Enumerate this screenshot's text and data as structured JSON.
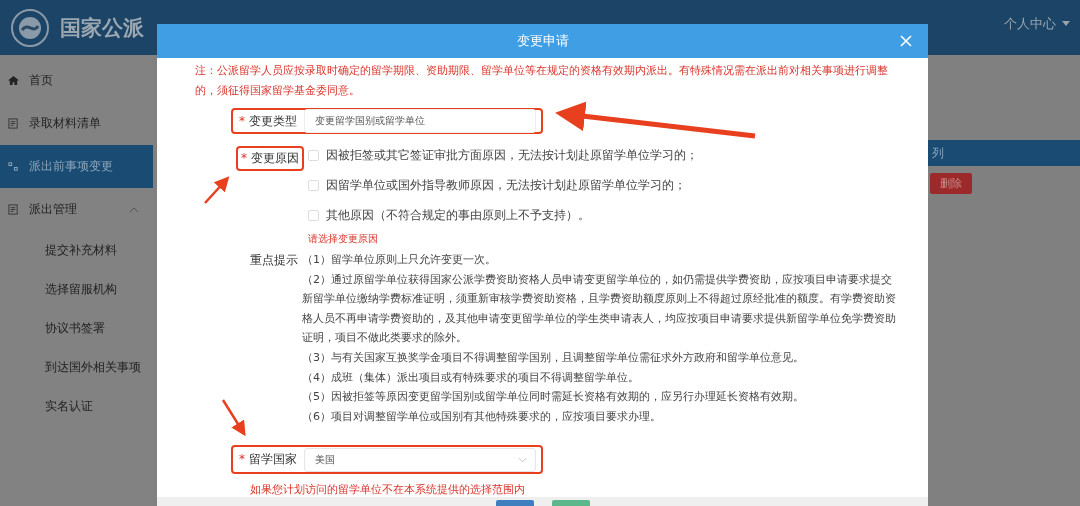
{
  "header": {
    "title": "国家公派",
    "user_menu": "个人中心"
  },
  "sidebar": {
    "items": [
      {
        "label": "首页",
        "selected": false
      },
      {
        "label": "录取材料清单",
        "selected": false
      },
      {
        "label": "派出前事项变更",
        "selected": true
      },
      {
        "label": "派出管理",
        "selected": false,
        "expanded": true,
        "children": [
          {
            "label": "提交补充材料",
            "selected": false
          },
          {
            "label": "选择留服机构",
            "selected": false
          },
          {
            "label": "协议书签署",
            "selected": false
          },
          {
            "label": "到达国外相关事项",
            "selected": false
          },
          {
            "label": "实名认证",
            "selected": false
          }
        ]
      }
    ]
  },
  "background_table": {
    "column_1": "列",
    "delete_button": "删除"
  },
  "dialog": {
    "title": "变更申请",
    "note": "注：公派留学人员应按录取时确定的留学期限、资助期限、留学单位等在规定的资格有效期内派出。有特殊情况需在派出前对相关事项进行调整的，须征得国家留学基金委同意。",
    "change_type": {
      "mark": "*",
      "label": "变更类型",
      "value": "变更留学国别或留学单位"
    },
    "change_reason": {
      "mark": "*",
      "label": "变更原因",
      "options": [
        {
          "label": "因被拒签或其它签证审批方面原因，无法按计划赴原留学单位学习的；",
          "checked": false
        },
        {
          "label": "因留学单位或国外指导教师原因，无法按计划赴原留学单位学习的；",
          "checked": false
        },
        {
          "label": "其他原因（不符合规定的事由原则上不予支持）。",
          "checked": false
        }
      ],
      "error": "请选择变更原因"
    },
    "tips": {
      "label": "重点提示",
      "items": [
        "（1）留学单位原则上只允许变更一次。",
        "（2）通过原留学单位获得国家公派学费资助资格人员申请变更留学单位的，如仍需提供学费资助，应按项目申请要求提交新留学单位缴纳学费标准证明，须重新审核学费资助资格，且学费资助额度原则上不得超过原经批准的额度。有学费资助资格人员不再申请学费资助的，及其他申请变更留学单位的学生类申请表人，均应按项目申请要求提供新留学单位免学费资助证明，项目不做此类要求的除外。",
        "（3）与有关国家互换奖学金项目不得调整留学国别，且调整留学单位需征求外方政府和留学单位意见。",
        "（4）成班（集体）派出项目或有特殊要求的项目不得调整留学单位。",
        "（5）因被拒签等原因变更留学国别或留学单位同时需延长资格有效期的，应另行办理延长资格有效期。",
        "（6）项目对调整留学单位或国别有其他特殊要求的，应按项目要求办理。"
      ]
    },
    "country": {
      "mark": "*",
      "label": "留学国家",
      "value": "美国"
    },
    "bottom_note": "如果您计划访问的留学单位不在本系统提供的选择范围内"
  }
}
